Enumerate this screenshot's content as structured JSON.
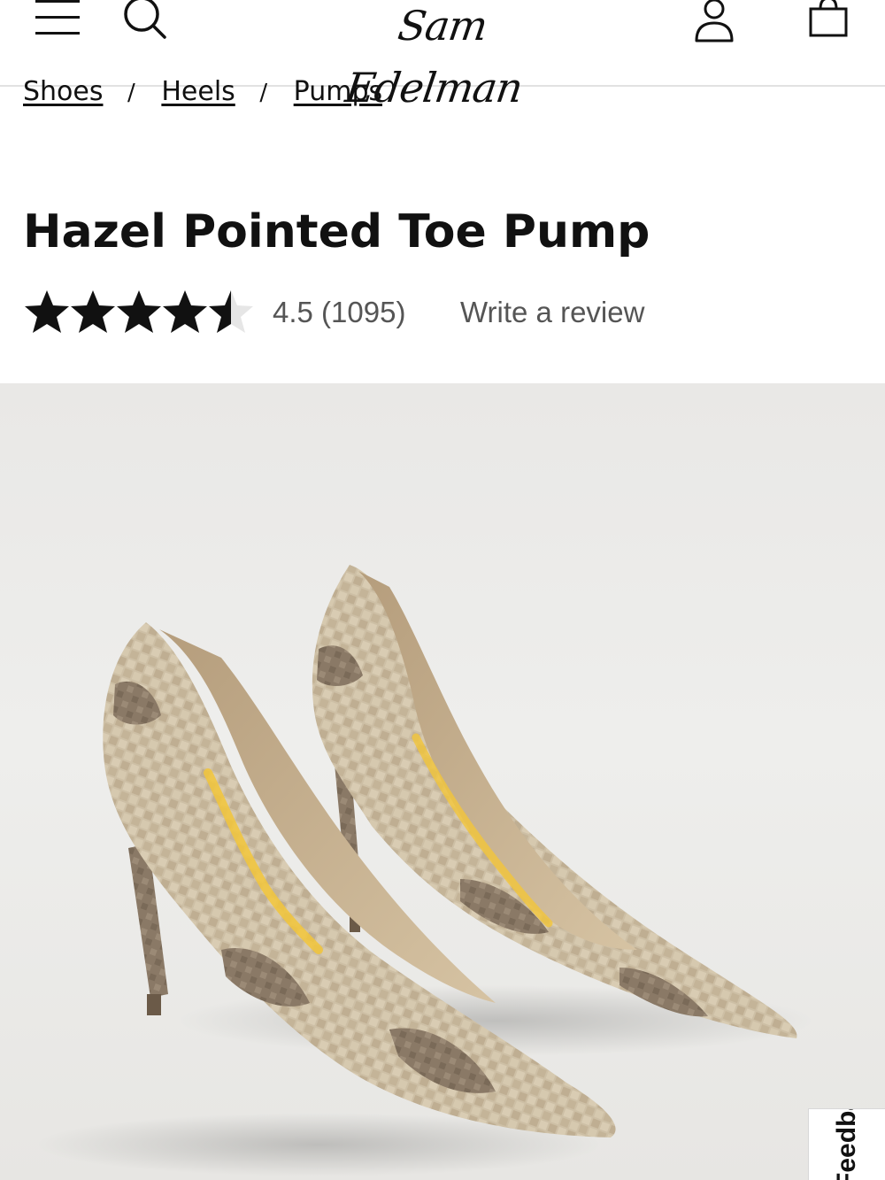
{
  "header": {
    "logo_text": "Sam Edelman",
    "icons": [
      "menu-icon",
      "search-icon",
      "account-icon",
      "shopping-bag-icon"
    ]
  },
  "breadcrumb": {
    "items": [
      "Shoes",
      "Heels",
      "Pumps"
    ],
    "separator": "/"
  },
  "product": {
    "title": "Hazel Pointed Toe Pump",
    "rating_value": 4.5,
    "rating_max": 5,
    "rating_text": "4.5 (1095)",
    "write_review_label": "Write a review",
    "image_alt": "Hazel Pointed Toe Pump in snake print"
  },
  "feedback_tab": {
    "label": "Feedback"
  },
  "colors": {
    "text": "#111111",
    "muted_text": "#555555",
    "image_bg": "#ebeae8",
    "header_border": "#e2e2e2"
  }
}
